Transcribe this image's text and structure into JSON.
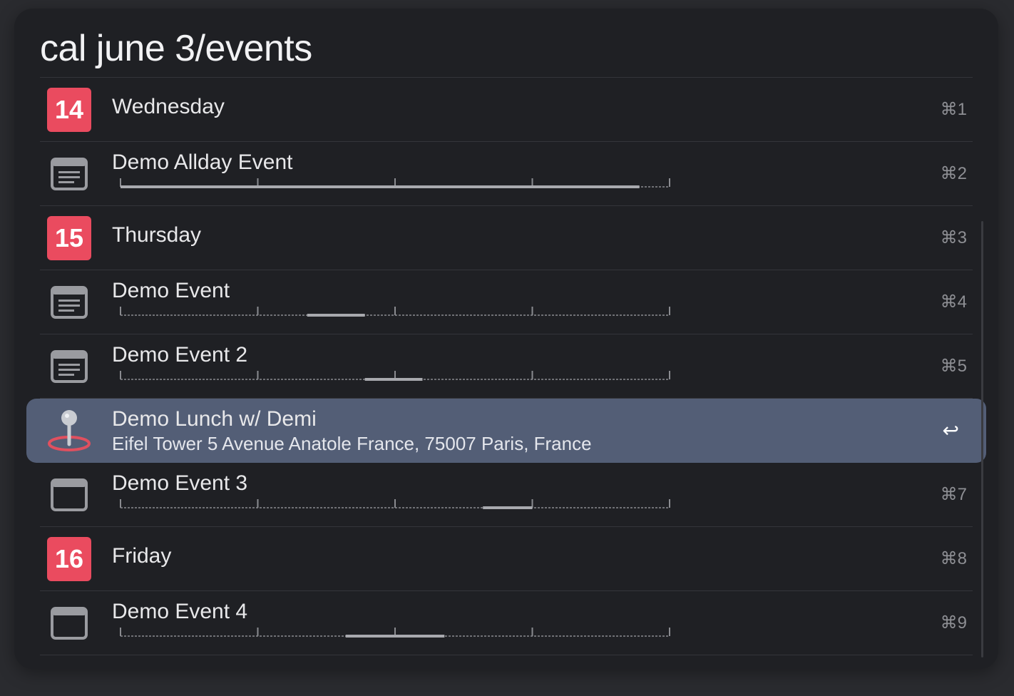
{
  "title": "cal june 3/events",
  "rows": [
    {
      "type": "day",
      "day_number": "14",
      "label": "Wednesday",
      "shortcut": "⌘1"
    },
    {
      "type": "event",
      "icon": "notes-icon",
      "label": "Demo Allday Event",
      "shortcut": "⌘2",
      "busy": [
        0.0,
        0.945
      ]
    },
    {
      "type": "day",
      "day_number": "15",
      "label": "Thursday",
      "shortcut": "⌘3"
    },
    {
      "type": "event",
      "icon": "notes-icon",
      "label": "Demo Event",
      "shortcut": "⌘4",
      "busy": [
        0.34,
        0.445
      ]
    },
    {
      "type": "event",
      "icon": "notes-icon",
      "label": "Demo Event 2",
      "shortcut": "⌘5",
      "busy": [
        0.445,
        0.55
      ]
    },
    {
      "type": "selected",
      "icon": "map-pin-icon",
      "label": "Demo Lunch w/ Demi",
      "sublabel": "Eifel Tower 5 Avenue Anatole France, 75007 Paris, France",
      "action_icon": "return-icon",
      "action_glyph": "↩"
    },
    {
      "type": "event",
      "icon": "calendar-icon",
      "label": "Demo Event 3",
      "shortcut": "⌘7",
      "busy": [
        0.66,
        0.75
      ]
    },
    {
      "type": "day",
      "day_number": "16",
      "label": "Friday",
      "shortcut": "⌘8"
    },
    {
      "type": "event",
      "icon": "calendar-icon",
      "label": "Demo Event 4",
      "shortcut": "⌘9",
      "busy": [
        0.41,
        0.59
      ]
    }
  ],
  "colors": {
    "background": "#1f2024",
    "selected": "#535e76",
    "badge": "#ea4b5f",
    "timeline": "#8a8b90",
    "pin": "#e0505f"
  }
}
